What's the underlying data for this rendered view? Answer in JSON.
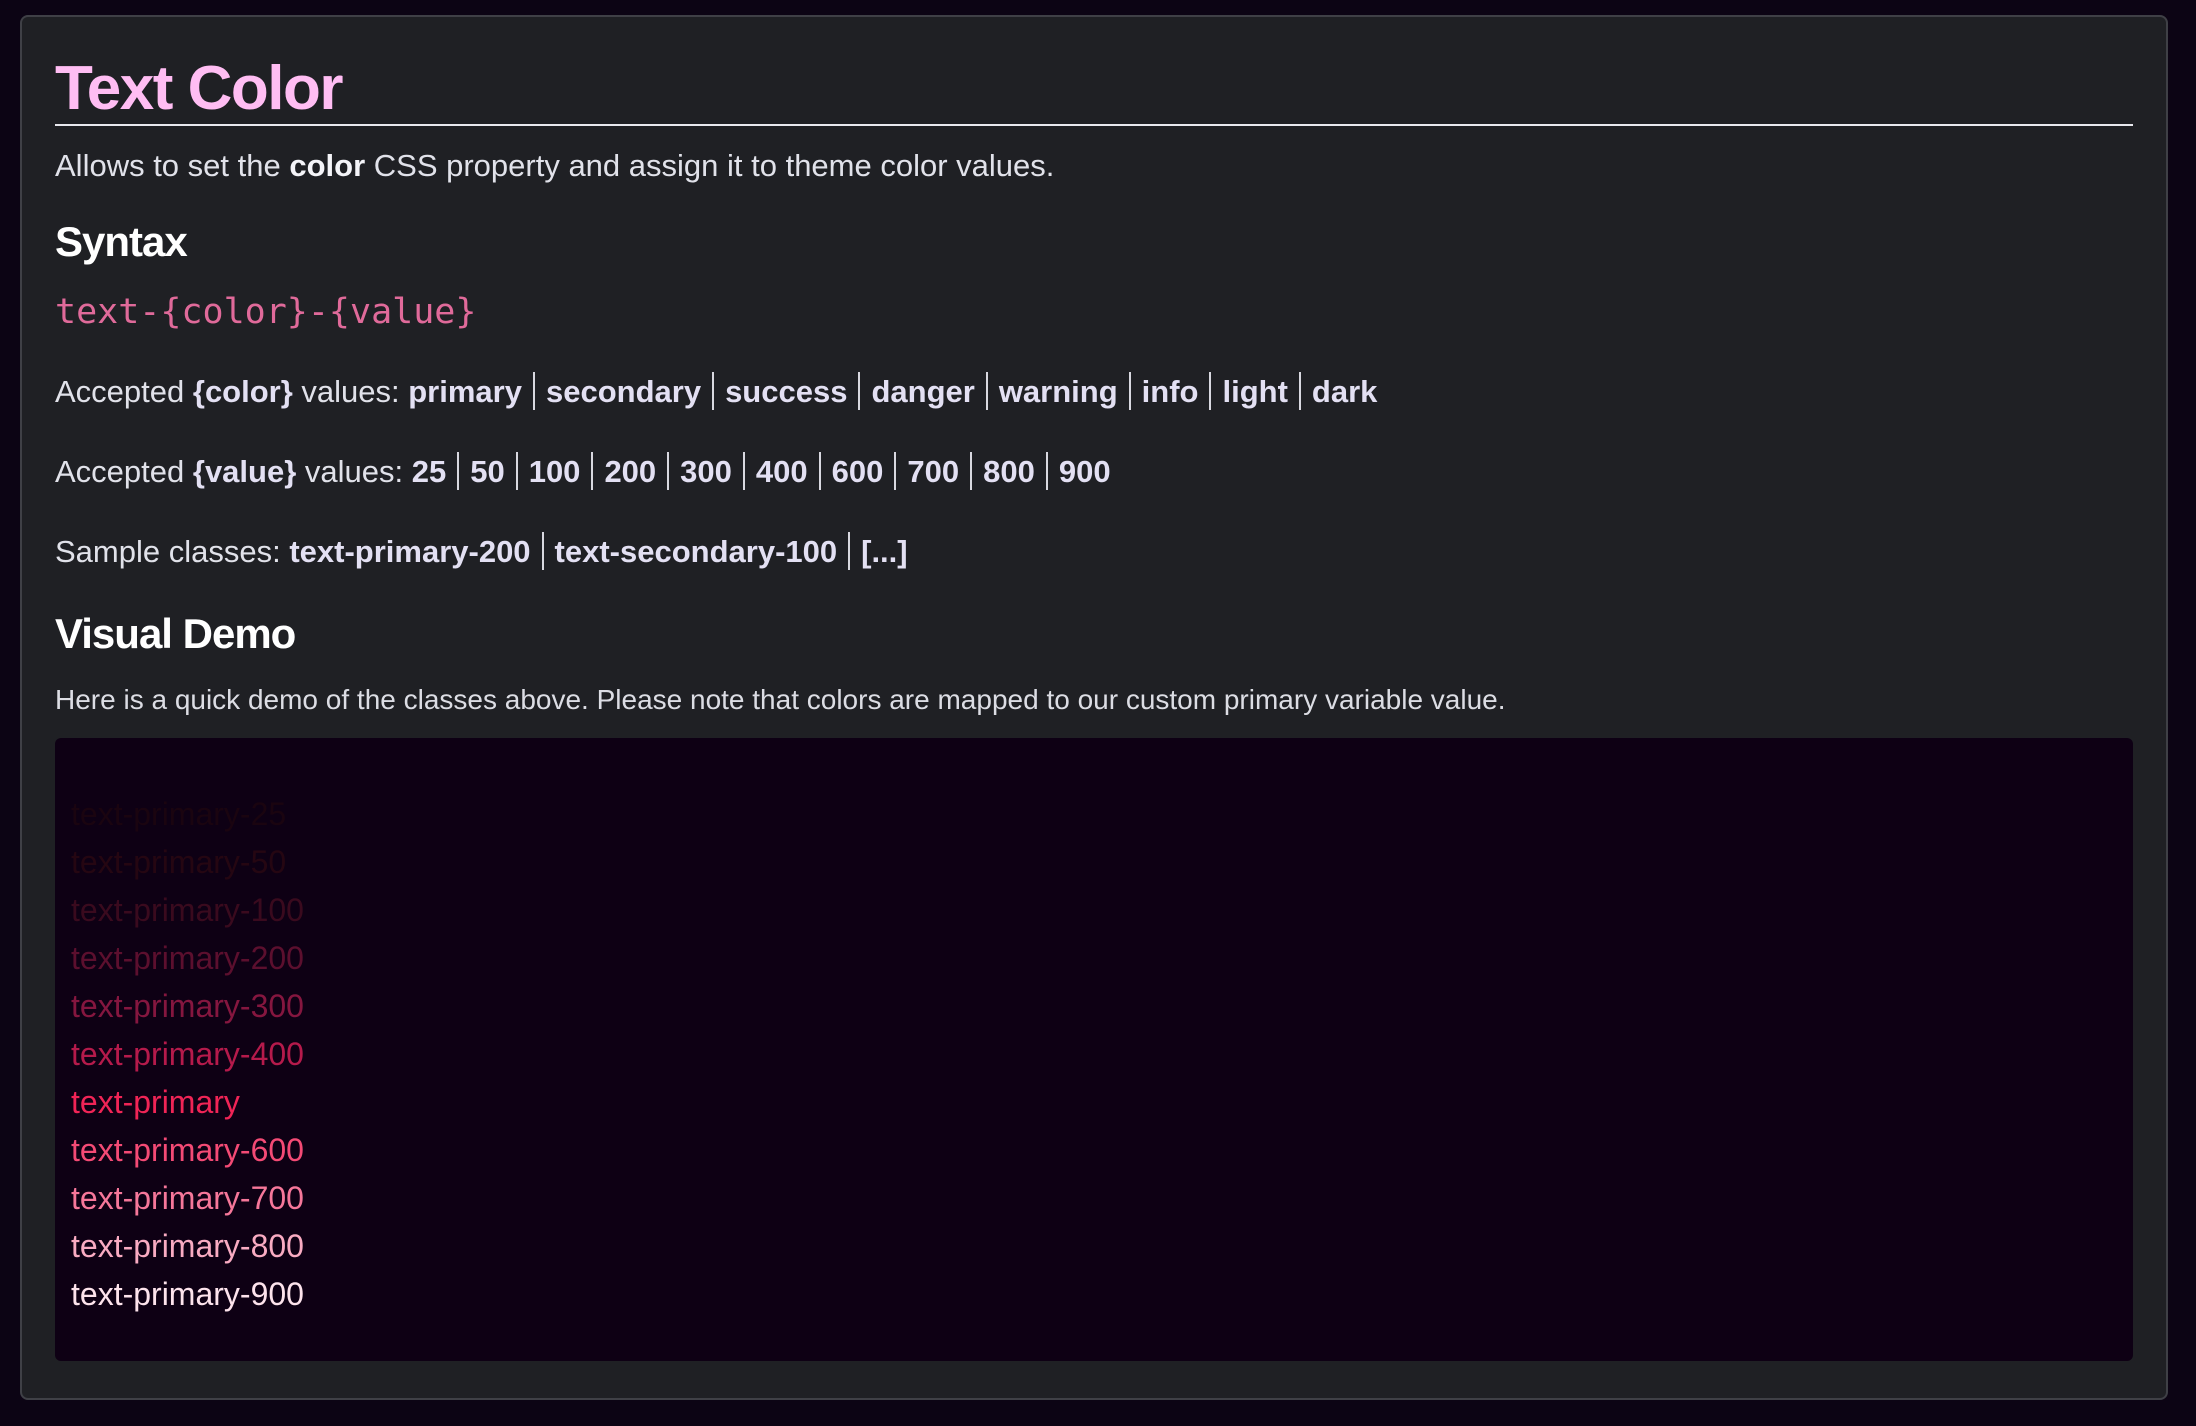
{
  "header": {
    "title": "Text Color"
  },
  "intro": {
    "before": "Allows to set the ",
    "bold": "color",
    "after": " CSS property and assign it to theme color values."
  },
  "syntax": {
    "heading": "Syntax",
    "code": "text-{color}-{value}"
  },
  "accepted_colors": {
    "prefix": "Accepted ",
    "param": "{color}",
    "suffix": " values: ",
    "items": [
      "primary",
      "secondary",
      "success",
      "danger",
      "warning",
      "info",
      "light",
      "dark"
    ]
  },
  "accepted_values": {
    "prefix": "Accepted ",
    "param": "{value}",
    "suffix": " values: ",
    "items": [
      "25",
      "50",
      "100",
      "200",
      "300",
      "400",
      "600",
      "700",
      "800",
      "900"
    ]
  },
  "samples": {
    "prefix": "Sample classes: ",
    "items": [
      "text-primary-200",
      "text-secondary-100",
      "[...]"
    ]
  },
  "demo": {
    "heading": "Visual Demo",
    "note": "Here is a quick demo of the classes above. Please note that colors are mapped to our custom primary variable value.",
    "items": [
      {
        "label": "text-primary-25",
        "color": "#1a0410"
      },
      {
        "label": "text-primary-50",
        "color": "#250612"
      },
      {
        "label": "text-primary-100",
        "color": "#3a0a1e"
      },
      {
        "label": "text-primary-200",
        "color": "#5c0f2e"
      },
      {
        "label": "text-primary-300",
        "color": "#85163f"
      },
      {
        "label": "text-primary-400",
        "color": "#b51a4b"
      },
      {
        "label": "text-primary",
        "color": "#f02456"
      },
      {
        "label": "text-primary-600",
        "color": "#f44a75"
      },
      {
        "label": "text-primary-700",
        "color": "#f6779a"
      },
      {
        "label": "text-primary-800",
        "color": "#f9abc2"
      },
      {
        "label": "text-primary-900",
        "color": "#fde3ec"
      }
    ]
  }
}
